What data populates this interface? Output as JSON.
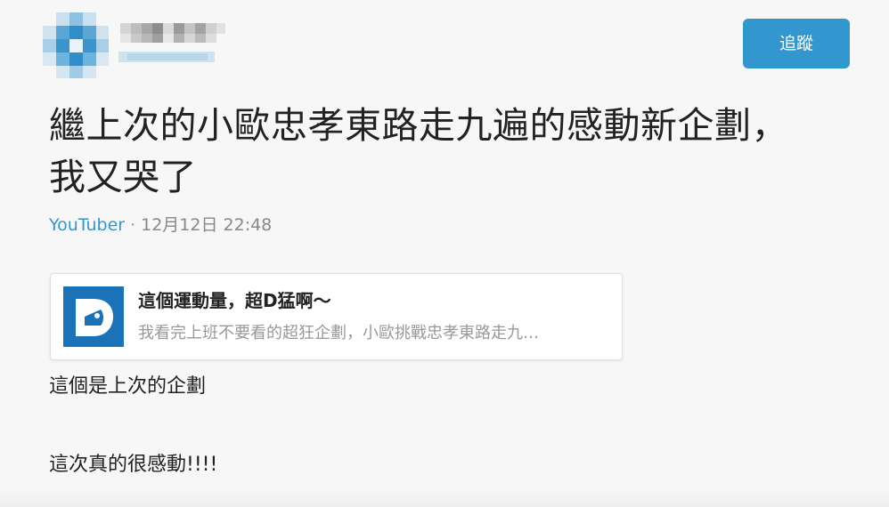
{
  "author": {
    "avatar_icon": "pixelated-avatar-icon",
    "name_icon": "blurred-name-icon"
  },
  "follow_button": {
    "label": "追蹤",
    "color": "#3397cf"
  },
  "post": {
    "title_line1": "繼上次的小歐忠孝東路走九遍的感動新企劃，",
    "title_line2": "我又哭了",
    "board": "YouTuber",
    "separator": "·",
    "timestamp": "12月12日 22:48"
  },
  "link_card": {
    "icon": "dcard-logo-icon",
    "title": "這個運動量，超D猛啊～",
    "description": "我看完上班不要看的超狂企劃，小歐挑戰忠孝東路走九…"
  },
  "content": {
    "line1": "這個是上次的企劃",
    "line2": "這次真的很感動!!!!"
  }
}
